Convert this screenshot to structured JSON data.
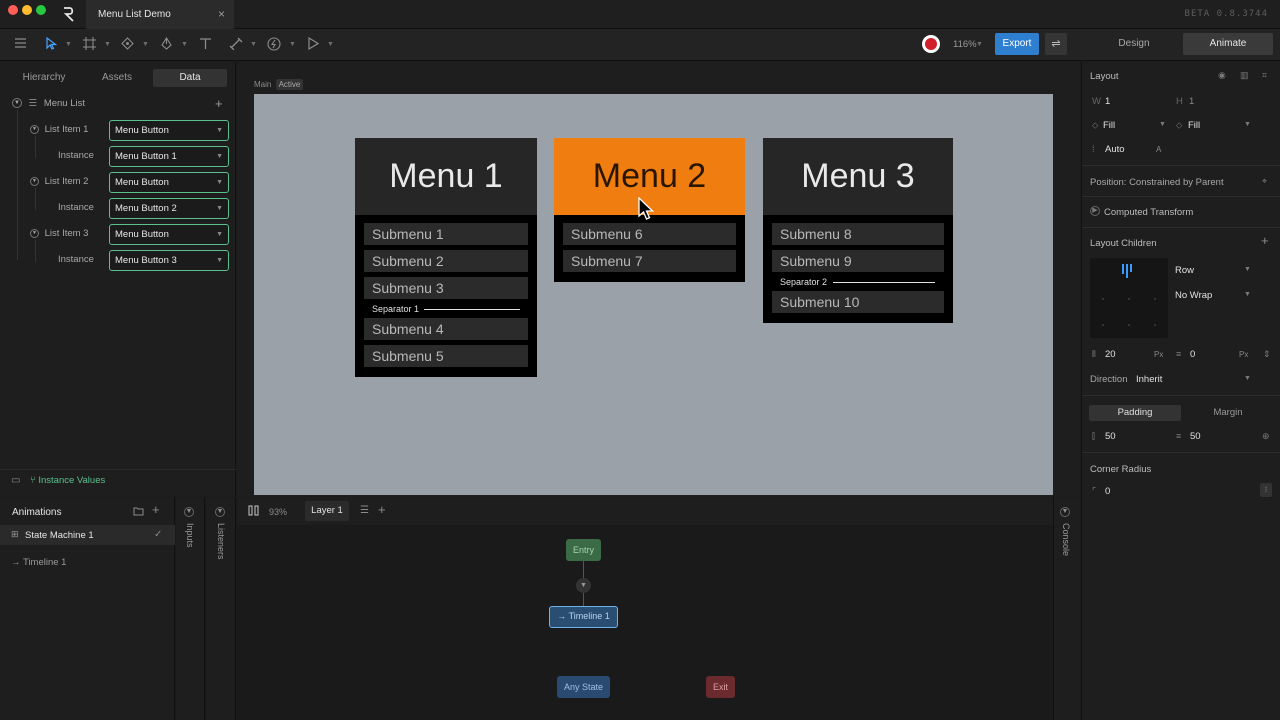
{
  "window": {
    "tab_title": "Menu List Demo",
    "tab_close": "×",
    "version": "BETA 0.8.3744"
  },
  "colors": {
    "accent": "#2f7fd0",
    "highlight": "#f07d10",
    "field_border": "#5ac08c"
  },
  "toolbar": {
    "zoom": "116%",
    "export_label": "Export",
    "swap_glyph": "⇌",
    "design_label": "Design",
    "animate_label": "Animate",
    "icons": [
      "menu-icon",
      "select-icon",
      "frame-icon",
      "shape-icon",
      "pen-icon",
      "text-icon",
      "bone-icon",
      "constraint-icon",
      "play-icon"
    ]
  },
  "left_panel": {
    "tabs": [
      "Hierarchy",
      "Assets",
      "Data"
    ],
    "root": "Menu List",
    "rows": [
      {
        "label": "List Item 1",
        "value": "Menu Button"
      },
      {
        "label": "Instance",
        "value": "Menu Button 1"
      },
      {
        "label": "List Item 2",
        "value": "Menu Button"
      },
      {
        "label": "Instance",
        "value": "Menu Button 2"
      },
      {
        "label": "List Item 3",
        "value": "Menu Button"
      },
      {
        "label": "Instance",
        "value": "Menu Button 3"
      }
    ],
    "footer": "Instance Values"
  },
  "canvas": {
    "breadcrumb_main": "Main",
    "breadcrumb_active": "Active",
    "menus": [
      {
        "title": "Menu 1",
        "items": [
          "Submenu 1",
          "Submenu 2",
          "Submenu 3",
          "Separator 1",
          "Submenu 4",
          "Submenu 5"
        ]
      },
      {
        "title": "Menu 2",
        "items": [
          "Submenu 6",
          "Submenu 7"
        ]
      },
      {
        "title": "Menu 3",
        "items": [
          "Submenu 8",
          "Submenu 9",
          "Separator 2",
          "Submenu 10"
        ]
      }
    ]
  },
  "animations": {
    "title": "Animations",
    "state_machine": "State Machine 1",
    "timeline": "Timeline 1",
    "inputs_label": "Inputs",
    "listeners_label": "Listeners",
    "zoom": "93%",
    "layer": "Layer 1",
    "console_label": "Console",
    "nodes": {
      "entry": "Entry",
      "timeline": "Timeline 1",
      "any_state": "Any State",
      "exit": "Exit"
    }
  },
  "right_panel": {
    "layout_title": "Layout",
    "w_label": "W",
    "w_value": "1",
    "h_label": "H",
    "h_value": "1",
    "fill_w": "Fill",
    "fill_h": "Fill",
    "auto": "Auto",
    "auto_a": "A",
    "position": "Position: Constrained by Parent",
    "computed_transform": "Computed Transform",
    "layout_children": "Layout Children",
    "direction_row": "Row",
    "wrap": "No Wrap",
    "gap_value": "20",
    "gap_unit": "Px",
    "gap2_value": "0",
    "gap2_unit": "Px",
    "direction_label": "Direction",
    "direction_value": "Inherit",
    "padding_label": "Padding",
    "margin_label": "Margin",
    "pad_value_1": "50",
    "pad_value_2": "50",
    "corner_radius_label": "Corner Radius",
    "corner_radius_value": "0"
  }
}
